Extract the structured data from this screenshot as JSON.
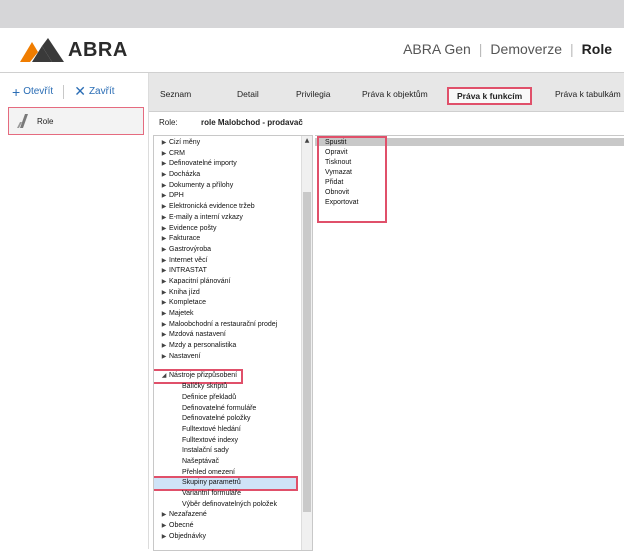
{
  "header": {
    "logo_text": "ABRA",
    "product": "ABRA Gen",
    "company": "Demoverze",
    "section": "Role"
  },
  "left_panel": {
    "open_label": "Otevřít",
    "close_label": "Zavřít",
    "role_item": "Role"
  },
  "tabs": [
    {
      "label": "Seznam"
    },
    {
      "label": "Detail"
    },
    {
      "label": "Privilegia"
    },
    {
      "label": "Práva k objektům"
    },
    {
      "label": "Práva k funkcím"
    },
    {
      "label": "Práva k tabulkám"
    }
  ],
  "role_bar": {
    "key": "Role:",
    "value": "role Malobchod - prodavač"
  },
  "tree": {
    "items": [
      "Cizí měny",
      "CRM",
      "Definovatelné importy",
      "Docházka",
      "Dokumenty a přílohy",
      "DPH",
      "Elektronická evidence tržeb",
      "E-maily a interní vzkazy",
      "Evidence pošty",
      "Fakturace",
      "Gastrovýroba",
      "Internet věcí",
      "INTRASTAT",
      "Kapacitní plánování",
      "Kniha jízd",
      "Kompletace",
      "Majetek",
      "Maloobchodní a restaurační prodej",
      "Mzdová nastavení",
      "Mzdy a personalistika",
      "Nastavení",
      "Nástroje přizpůsobení",
      "Balíčky skriptů",
      "Definice překladů",
      "Definovatelné formuláře",
      "Definovatelné položky",
      "Fulltextové hledání",
      "Fulltextové indexy",
      "Instalační sady",
      "Našeptávač",
      "Přehled omezení",
      "Skupiny parametrů",
      "Variantní formuláře",
      "Výběr definovatelných položek",
      "Nezařazené",
      "Obecné",
      "Objednávky"
    ]
  },
  "functions": {
    "items": [
      "Spustit",
      "Opravit",
      "Tisknout",
      "Vymazat",
      "Přidat",
      "Obnovit",
      "Exportovat"
    ]
  },
  "colors": {
    "highlight": "#e0506a",
    "link": "#2a6db5",
    "logo_orange": "#f07d00",
    "logo_dark": "#3a3a3a"
  }
}
